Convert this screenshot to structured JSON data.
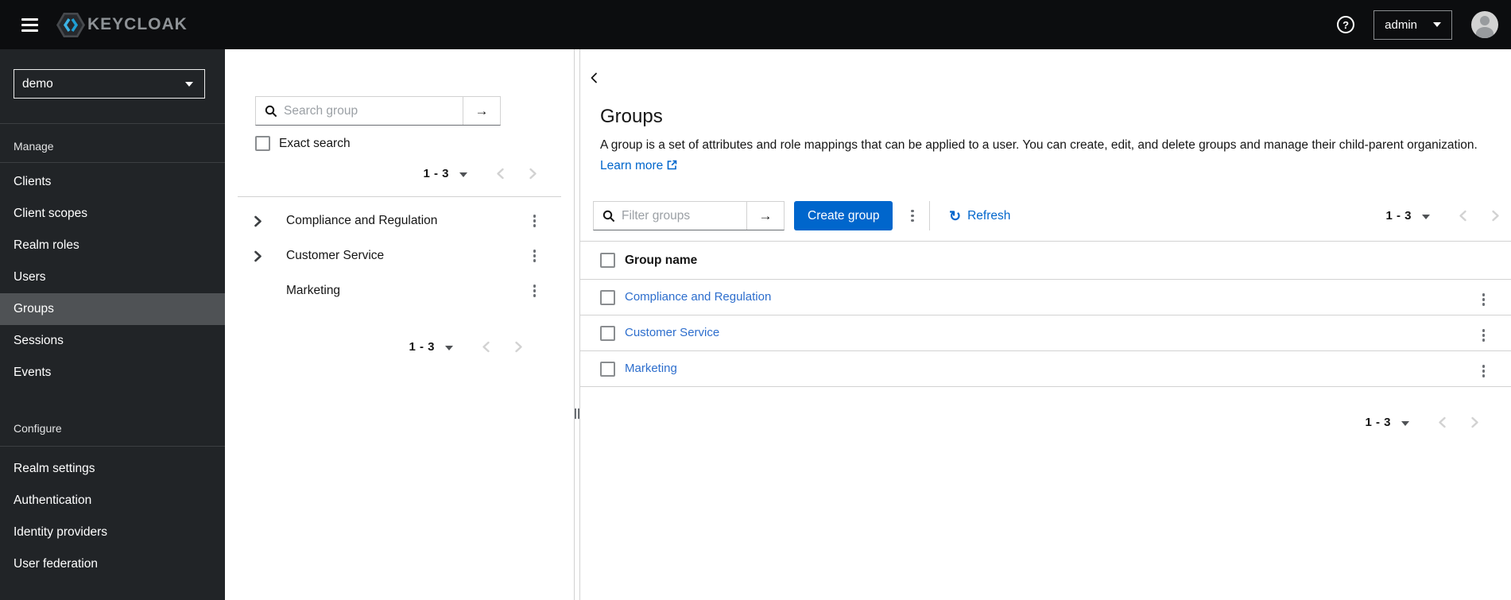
{
  "masthead": {
    "brand": "KEYCLOAK",
    "user": "admin"
  },
  "icons": {
    "help": "?",
    "submit_arrow": "→",
    "refresh": "↻"
  },
  "sidebar": {
    "realm_selector": {
      "value": "demo"
    },
    "selected_item": "Groups",
    "sections": [
      {
        "label": "Manage",
        "items": [
          "Clients",
          "Client scopes",
          "Realm roles",
          "Users",
          "Groups",
          "Sessions",
          "Events"
        ]
      },
      {
        "label": "Configure",
        "items": [
          "Realm settings",
          "Authentication",
          "Identity providers",
          "User federation"
        ]
      }
    ]
  },
  "tree_panel": {
    "search_placeholder": "Search group",
    "exact_search_label": "Exact search",
    "pagination_top": {
      "range": "1 - 3"
    },
    "pagination_bottom": {
      "range": "1 - 3"
    },
    "groups": [
      {
        "label": "Compliance and Regulation",
        "expandable": true
      },
      {
        "label": "Customer Service",
        "expandable": true
      },
      {
        "label": "Marketing",
        "expandable": false
      }
    ]
  },
  "main": {
    "title": "Groups",
    "description": "A group is a set of attributes and role mappings that can be applied to a user. You can create, edit, and delete groups and manage their child-parent organization.",
    "learn_more": "Learn more",
    "toolbar": {
      "filter_placeholder": "Filter groups",
      "create_button": "Create group",
      "refresh": "Refresh",
      "pagination": {
        "range": "1 - 3"
      }
    },
    "table": {
      "columns": [
        "Group name"
      ],
      "rows": [
        {
          "name": "Compliance and Regulation"
        },
        {
          "name": "Customer Service"
        },
        {
          "name": "Marketing"
        }
      ]
    },
    "pagination_bottom": {
      "range": "1 - 3"
    }
  },
  "colors": {
    "accent": "#0066cc",
    "masthead_bg": "#0c0d0f",
    "sidebar_bg": "#212427",
    "sidebar_selected_bg": "#4f5255",
    "row_link": "#2d6ecd",
    "border": "#d2d2d2",
    "disabled_chevron": "#d2d2d2"
  }
}
